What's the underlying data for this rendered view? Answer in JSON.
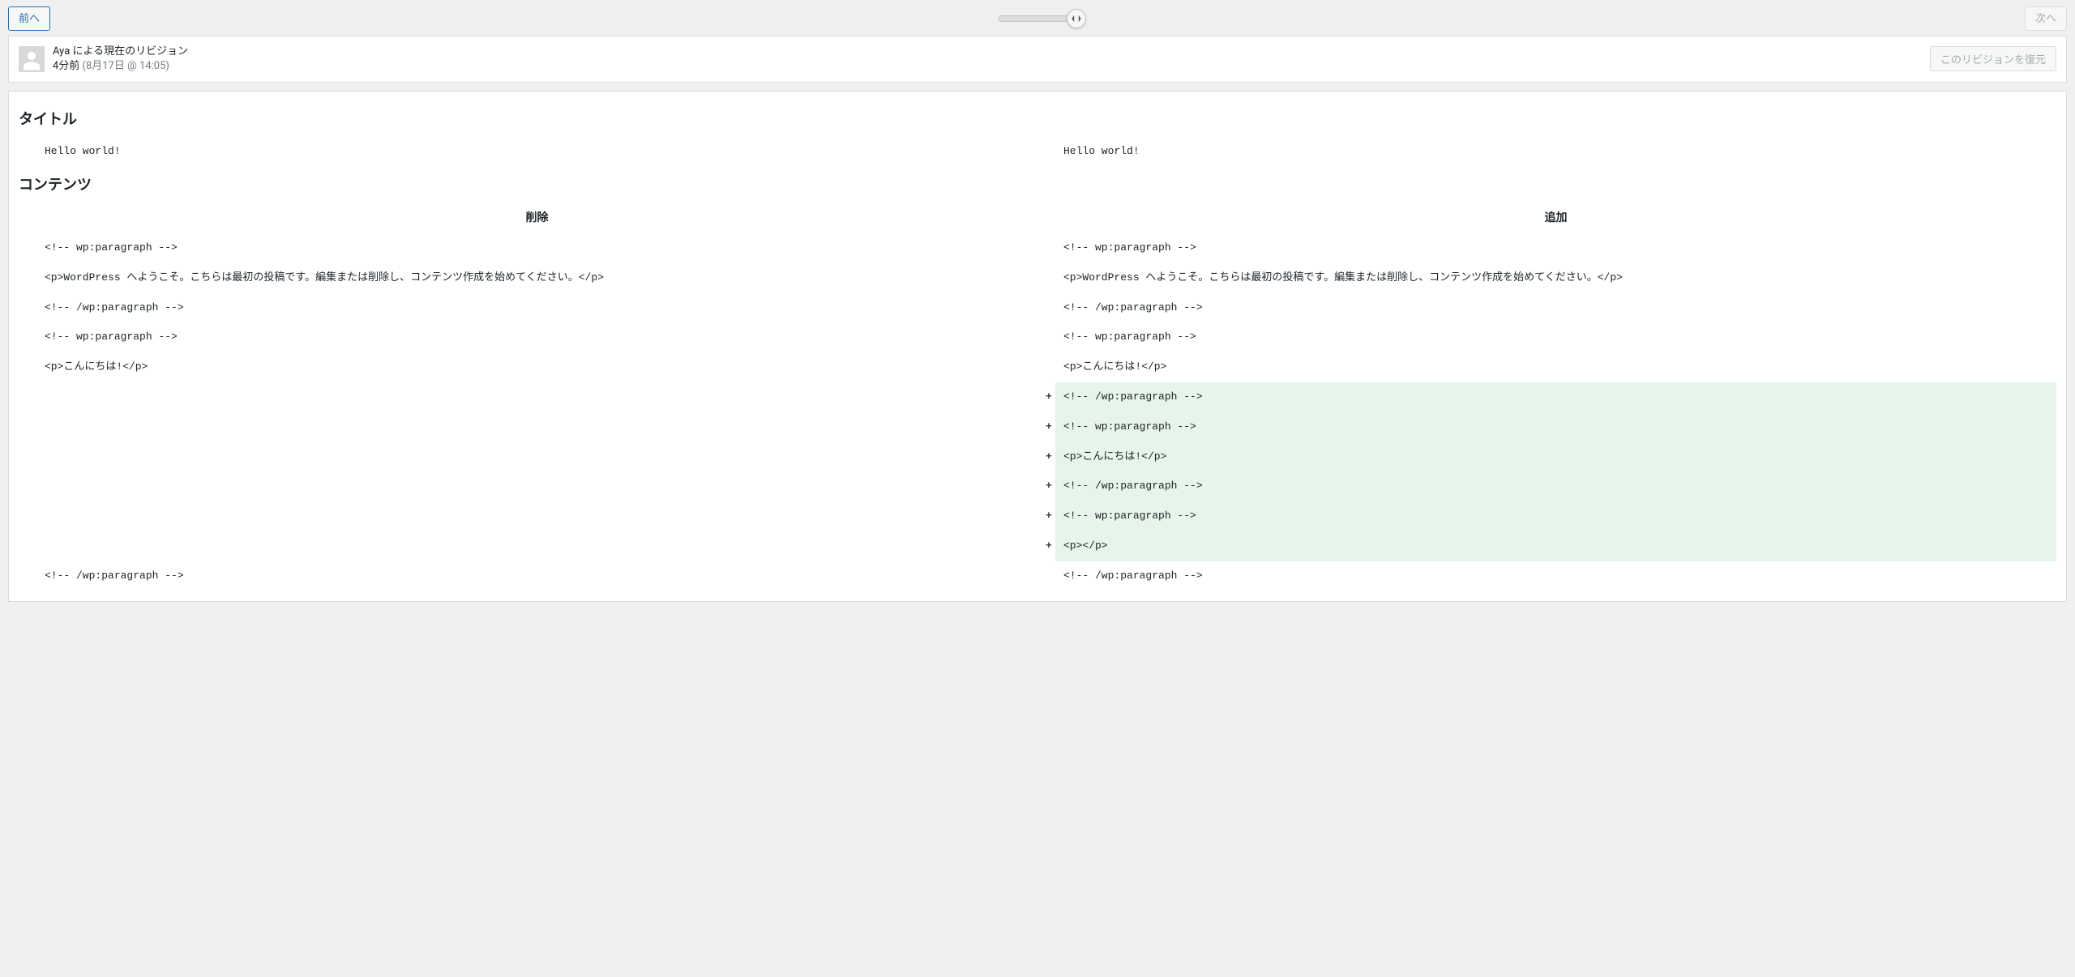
{
  "nav": {
    "prev_label": "前へ",
    "next_label": "次へ"
  },
  "meta": {
    "author_line": "Aya による現在のリビジョン",
    "time_ago": "4分前",
    "timestamp_paren": "(8月17日 @ 14:05)",
    "restore_label": "このリビジョンを復元"
  },
  "sections": {
    "title_heading": "タイトル",
    "content_heading": "コンテンツ",
    "deleted_header": "削除",
    "added_header": "追加"
  },
  "title_diff": {
    "left": "Hello world!",
    "right": "Hello world!"
  },
  "content_diff": [
    {
      "type": "context",
      "left": "<!-- wp:paragraph -->",
      "right": "<!-- wp:paragraph -->"
    },
    {
      "type": "context",
      "left": "<p>WordPress へようこそ。こちらは最初の投稿です。編集または削除し、コンテンツ作成を始めてください。</p>",
      "right": "<p>WordPress へようこそ。こちらは最初の投稿です。編集または削除し、コンテンツ作成を始めてください。</p>"
    },
    {
      "type": "context",
      "left": "<!-- /wp:paragraph -->",
      "right": "<!-- /wp:paragraph -->"
    },
    {
      "type": "context",
      "left": "<!-- wp:paragraph -->",
      "right": "<!-- wp:paragraph -->"
    },
    {
      "type": "context",
      "left": "<p>こんにちは!</p>",
      "right": "<p>こんにちは!</p>"
    },
    {
      "type": "added",
      "right": "<!-- /wp:paragraph -->"
    },
    {
      "type": "added",
      "right": "<!-- wp:paragraph -->"
    },
    {
      "type": "added",
      "right": "<p>こんにちは!</p>"
    },
    {
      "type": "added",
      "right": "<!-- /wp:paragraph -->"
    },
    {
      "type": "added",
      "right": "<!-- wp:paragraph -->"
    },
    {
      "type": "added",
      "right": "<p></p>"
    },
    {
      "type": "context",
      "left": "<!-- /wp:paragraph -->",
      "right": "<!-- /wp:paragraph -->"
    }
  ]
}
